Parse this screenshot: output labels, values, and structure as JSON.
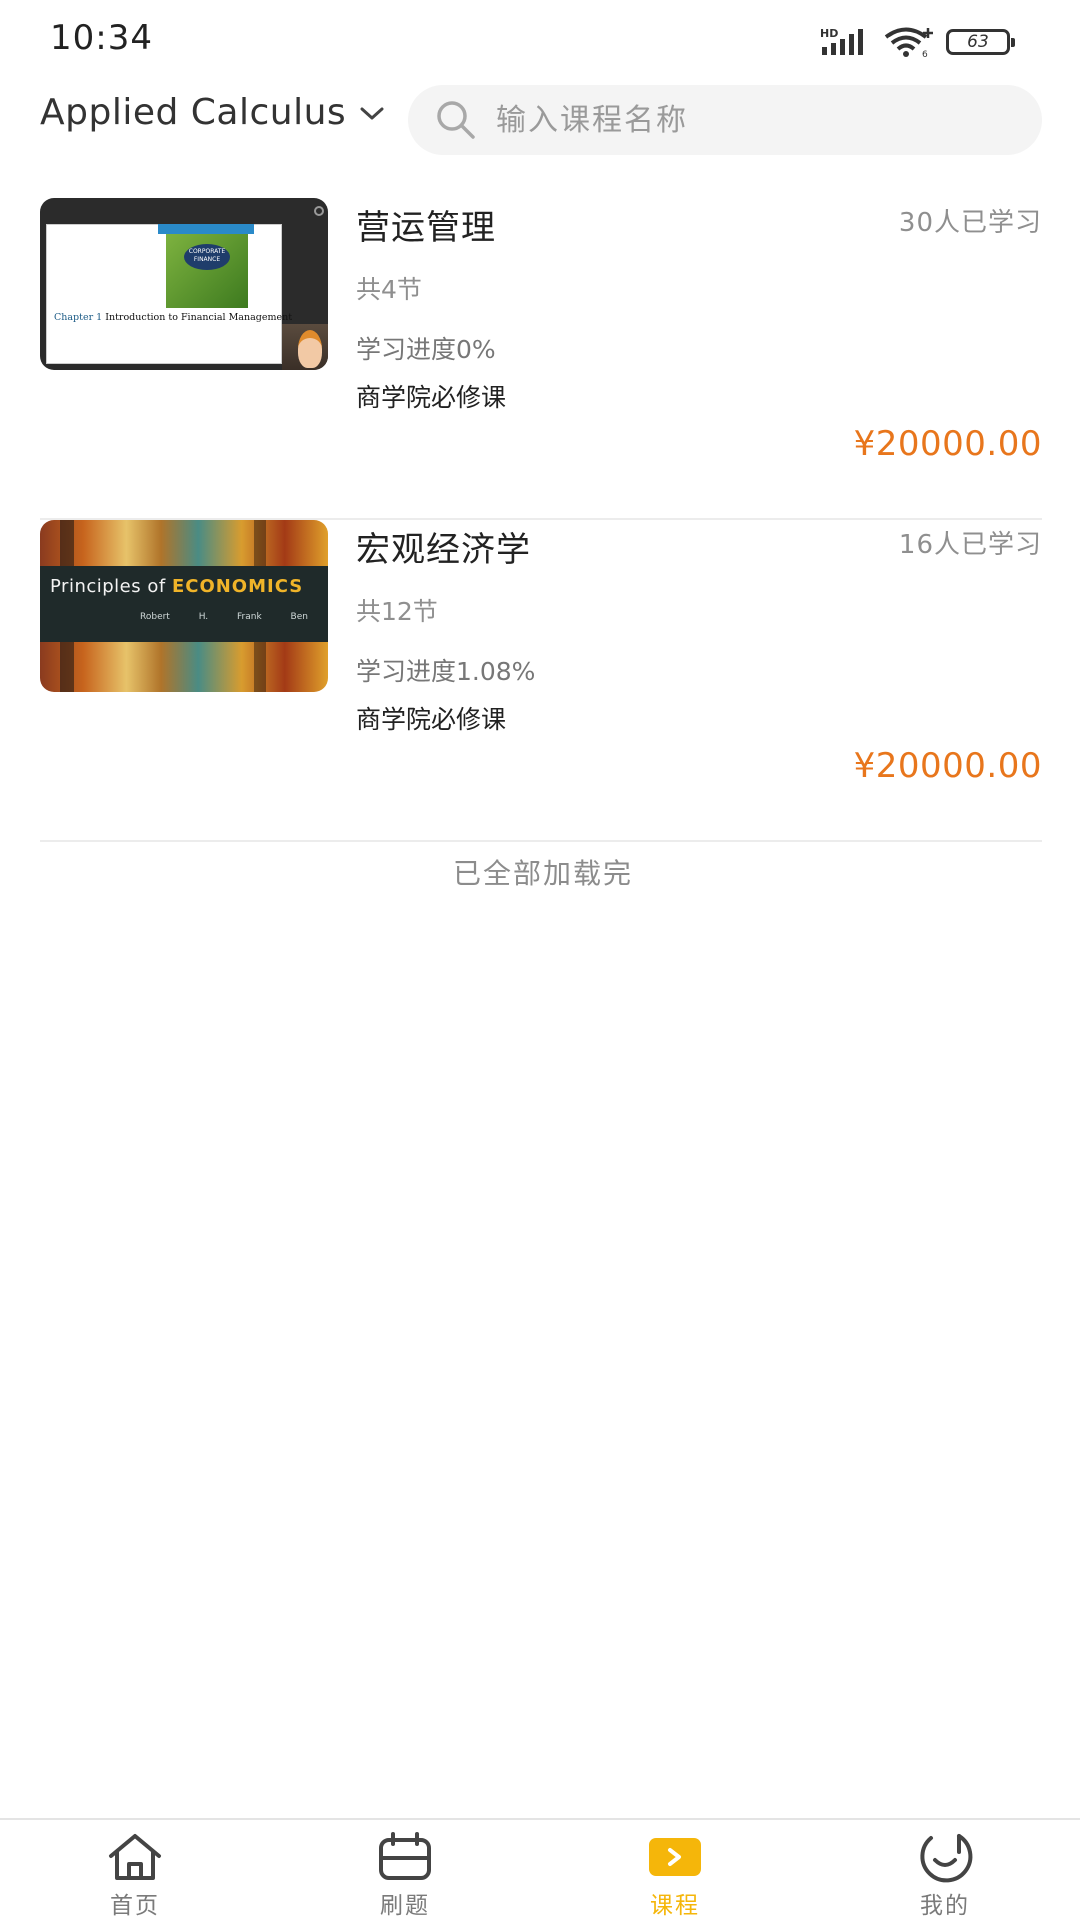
{
  "status_bar": {
    "time": "10:34",
    "network": "HD",
    "battery": "63"
  },
  "header": {
    "course_select_label": "Applied Calculus",
    "search_placeholder": "输入课程名称"
  },
  "courses": [
    {
      "title": "营运管理",
      "learners": "30人已学习",
      "lessons": "共4节",
      "progress": "学习进度0%",
      "tag": "商学院必修课",
      "price": "¥20000.00",
      "thumb": {
        "chapter_label": "Chapter 1",
        "chapter_title": "Introduction to Financial Management",
        "book_text": "CORPORATE FINANCE"
      }
    },
    {
      "title": "宏观经济学",
      "learners": "16人已学习",
      "lessons": "共12节",
      "progress": "学习进度1.08%",
      "tag": "商学院必修课",
      "price": "¥20000.00",
      "thumb": {
        "title_prefix": "Principles of",
        "title_emphasis": "ECONOMICS",
        "authors": "Robert H. Frank Ben S. Bernanke"
      }
    }
  ],
  "list_footer": "已全部加载完",
  "bottom_nav": {
    "items": [
      {
        "label": "首页",
        "icon": "home-icon"
      },
      {
        "label": "刷题",
        "icon": "practice-icon"
      },
      {
        "label": "课程",
        "icon": "course-icon"
      },
      {
        "label": "我的",
        "icon": "profile-icon"
      }
    ],
    "active": "课程"
  },
  "colors": {
    "accent": "#f5b60a",
    "price": "#e8761c",
    "muted": "#8f8f8f"
  }
}
